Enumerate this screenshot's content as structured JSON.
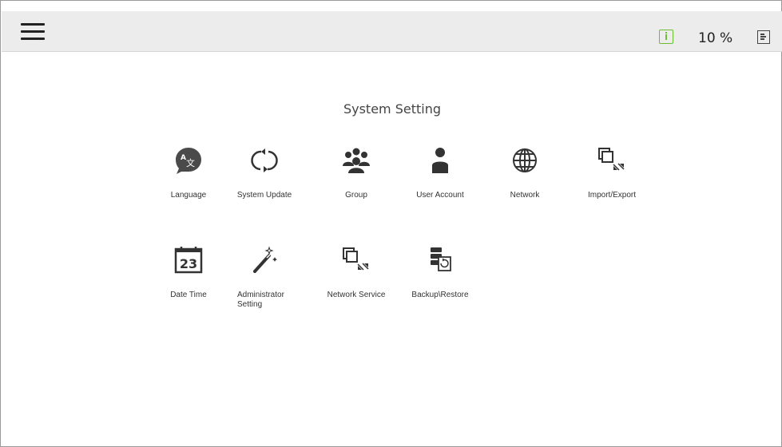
{
  "topbar": {
    "menu_icon": "hamburger-icon",
    "status_icon": "info-icon",
    "speed": "10 %",
    "log_icon": "log-icon",
    "status_color": "#6bbf2f"
  },
  "page": {
    "title": "System Setting"
  },
  "tiles": [
    {
      "label": "Language",
      "icon": "language-icon"
    },
    {
      "label": "System Update",
      "icon": "refresh-icon"
    },
    {
      "label": "Group",
      "icon": "group-icon"
    },
    {
      "label": "User Account",
      "icon": "user-icon"
    },
    {
      "label": "Network",
      "icon": "globe-icon"
    },
    {
      "label": "Import/Export",
      "icon": "import-export-icon"
    },
    {
      "label": "Date Time",
      "icon": "calendar-icon",
      "day": "23"
    },
    {
      "label": "Administrator Setting",
      "icon": "magic-wand-icon"
    },
    {
      "label": "Network Service",
      "icon": "network-service-icon"
    },
    {
      "label": "Backup\\Restore",
      "icon": "backup-restore-icon"
    }
  ]
}
